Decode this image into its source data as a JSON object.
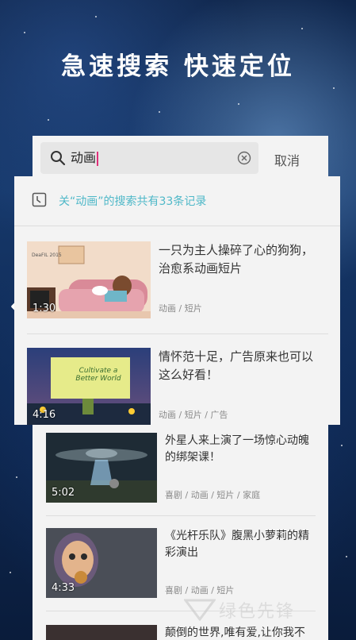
{
  "headline": "急速搜索  快速定位",
  "search": {
    "query": "动画",
    "cancel_label": "取消"
  },
  "result_count_text": "关“动画”的搜索共有33条记录",
  "results": [
    {
      "title_line1": "一只为主人操碎了心的狗狗，",
      "title_line2": "治愈系动画短片",
      "tags": "动画 / 短片",
      "duration": "1:30",
      "thumb_caption": "DeaFIL 2015"
    },
    {
      "title_line1": "情怀范十足，广告原来也可以",
      "title_line2": "这么好看！",
      "tags": "动画 / 短片 / 广告",
      "duration": "4:16",
      "thumb_caption": "Cultivate a Better World"
    },
    {
      "title_line1": "外星人来上演了一场惊心动魄",
      "title_line2": "的绑架课！",
      "tags": "喜剧 / 动画 / 短片 / 家庭",
      "duration": "5:02"
    },
    {
      "title_line1": "《光杆乐队》腹黑小萝莉的精",
      "title_line2": "彩演出",
      "tags": "喜剧 / 动画 / 短片",
      "duration": "4:33"
    },
    {
      "title_line1": "颠倒的世界,唯有爱,让你我不",
      "title_line2": "",
      "tags": "",
      "duration": ""
    }
  ],
  "watermark": "绿色先锋",
  "colors": {
    "accent_teal": "#4fb8c8",
    "caret": "#e0307a",
    "panel_bg": "#f3f3f3"
  }
}
